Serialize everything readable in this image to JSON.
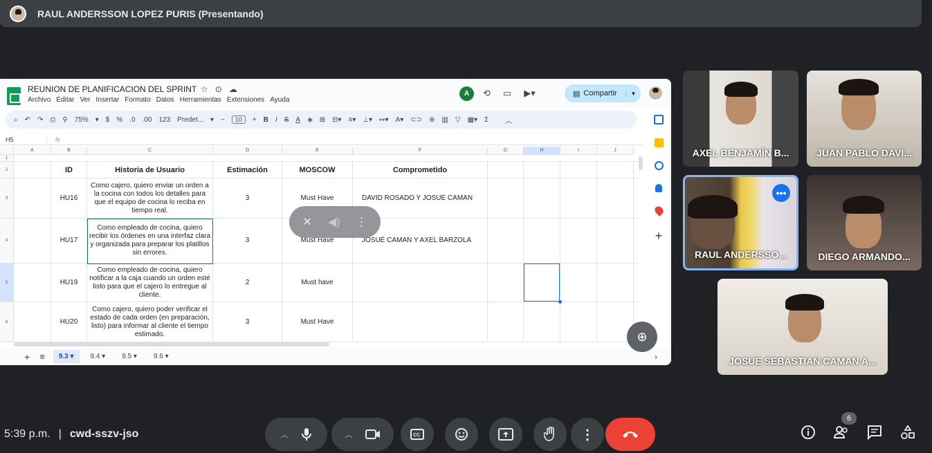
{
  "presenter_bar": {
    "title": "RAUL ANDERSSON LOPEZ PURIS (Presentando)"
  },
  "sheet": {
    "title": "REUNION DE PLANIFICACION DEL SPRINT",
    "menu": [
      "Archivo",
      "Editar",
      "Ver",
      "Insertar",
      "Formato",
      "Datos",
      "Herramientas",
      "Extensiones",
      "Ayuda"
    ],
    "user_initial": "A",
    "share_label": "Compartir",
    "toolbar": {
      "zoom": "75%",
      "currency": "$",
      "percent": "%",
      "dec_less": ".0",
      "dec_more": ".00",
      "number": "123",
      "font": "Predet...",
      "font_size": "10"
    },
    "name_box": "H5",
    "fx": "fx",
    "columns": [
      "A",
      "B",
      "C",
      "D",
      "E",
      "F",
      "G",
      "H",
      "I",
      "J"
    ],
    "header_row": {
      "num": "2",
      "id": "ID",
      "story": "Historia de Usuario",
      "estimate": "Estimación",
      "moscow": "MOSCOW",
      "committed": "Comprometido"
    },
    "rows": [
      {
        "num": "3",
        "id": "HU16",
        "story": "Como cajero, quiero enviar un orden a la cocina con todos los detalles para que el equipo de cocina lo reciba en tiempo real.",
        "estimate": "3",
        "moscow": "Must Have",
        "committed": "DAVID ROSADO Y JOSUE CAMAN"
      },
      {
        "num": "4",
        "id": "HU17",
        "story": "Como empleado de cocina, quiero recibir los órdenes en una interfaz clara y organizada para preparar los platillos sin errores.",
        "estimate": "3",
        "moscow": "Must Have",
        "committed": "JOSUÉ CAMAN Y AXEL BARZOLA"
      },
      {
        "num": "5",
        "id": "HU19",
        "story": "Como empleado de cocina, quiero notificar a la caja cuando un orden esté listo para que el cajero lo entregue al cliente.",
        "estimate": "2",
        "moscow": "Must have",
        "committed": ""
      },
      {
        "num": "6",
        "id": "HU20",
        "story": "Como cajero, quiero poder verificar el estado de cada orden (en preparación, listo) para informar al cliente el tiempo estimado.",
        "estimate": "3",
        "moscow": "Must Have",
        "committed": ""
      }
    ],
    "row1_num": "1",
    "tabs": [
      "9.3",
      "9.4",
      "9.5",
      "9.6"
    ],
    "active_tab": "9.3"
  },
  "participants": [
    {
      "name": "AXEL BENJAMÍN B..."
    },
    {
      "name": "JUAN PABLO DAVI..."
    },
    {
      "name": "RAUL ANDERSSO..."
    },
    {
      "name": "DIEGO ARMANDO..."
    },
    {
      "name": "JOSUE SEBASTIAN CAMAN A..."
    }
  ],
  "meeting": {
    "time": "5:39 p.m.",
    "code": "cwd-sszv-jso",
    "people_count": "6"
  },
  "colors": {
    "end_call": "#ea4335",
    "accent": "#1a73e8",
    "sheets_green": "#0f9d58"
  }
}
